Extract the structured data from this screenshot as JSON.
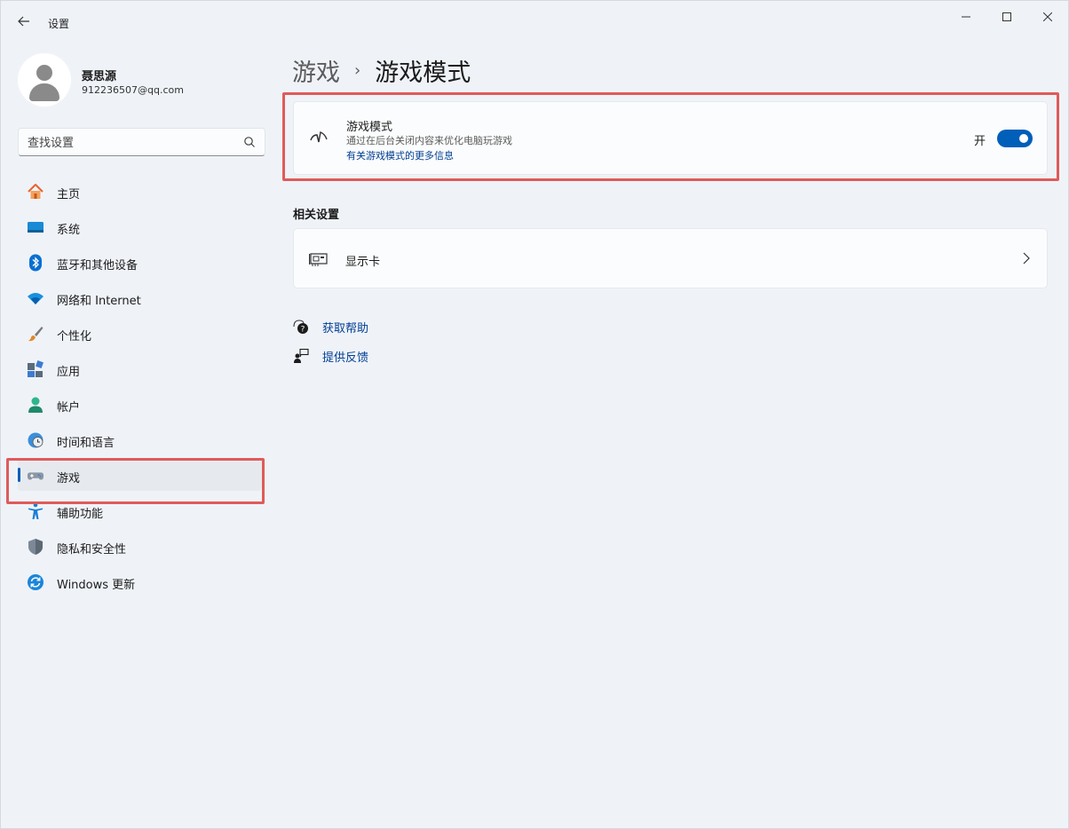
{
  "window": {
    "title": "设置",
    "controls": [
      "minimize",
      "maximize",
      "close"
    ]
  },
  "profile": {
    "name": "聂思源",
    "email": "912236507@qq.com"
  },
  "search": {
    "placeholder": "查找设置"
  },
  "sidebar": {
    "items": [
      {
        "label": "主页",
        "icon": "home-icon"
      },
      {
        "label": "系统",
        "icon": "monitor-icon"
      },
      {
        "label": "蓝牙和其他设备",
        "icon": "bluetooth-icon"
      },
      {
        "label": "网络和 Internet",
        "icon": "wifi-icon"
      },
      {
        "label": "个性化",
        "icon": "paintbrush-icon"
      },
      {
        "label": "应用",
        "icon": "apps-icon"
      },
      {
        "label": "帐户",
        "icon": "account-icon"
      },
      {
        "label": "时间和语言",
        "icon": "clock-globe-icon"
      },
      {
        "label": "游戏",
        "icon": "gamepad-icon",
        "selected": true
      },
      {
        "label": "辅助功能",
        "icon": "accessibility-icon"
      },
      {
        "label": "隐私和安全性",
        "icon": "shield-icon"
      },
      {
        "label": "Windows 更新",
        "icon": "update-icon"
      }
    ]
  },
  "breadcrumb": {
    "parent": "游戏",
    "separator": "›",
    "current": "游戏模式"
  },
  "game_mode": {
    "title": "游戏模式",
    "description": "通过在后台关闭内容来优化电脑玩游戏",
    "link": "有关游戏模式的更多信息",
    "toggle_state_label": "开",
    "toggle_on": true
  },
  "related": {
    "title": "相关设置",
    "items": [
      {
        "label": "显示卡",
        "icon": "graphics-card-icon"
      }
    ]
  },
  "help": {
    "get_help": "获取帮助",
    "feedback": "提供反馈"
  },
  "colors": {
    "accent": "#005fb8",
    "highlight": "#e05a5a",
    "link": "#003e92"
  }
}
